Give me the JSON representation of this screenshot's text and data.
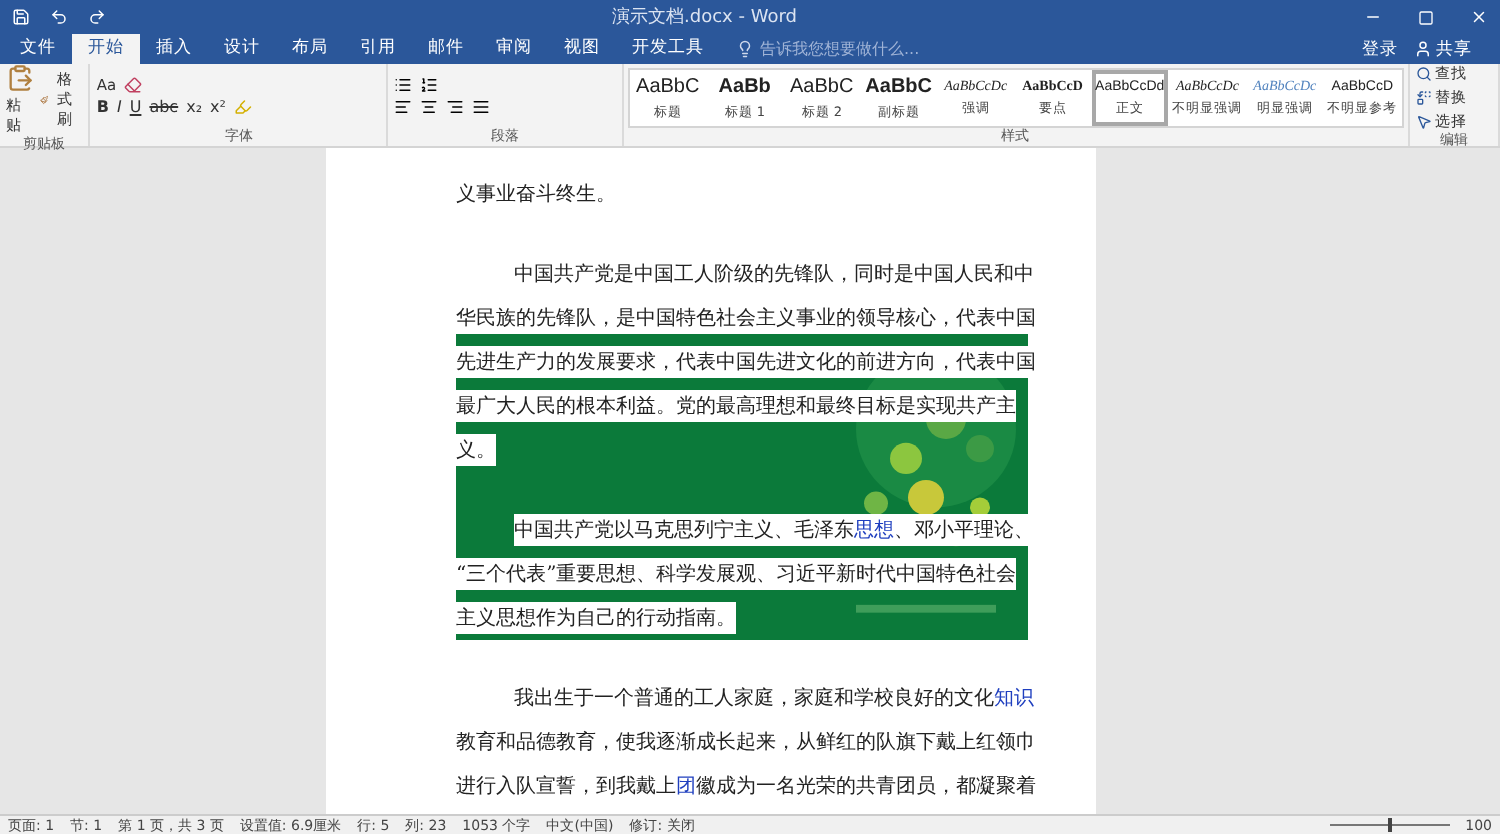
{
  "window": {
    "title": "演示文档.docx - Word"
  },
  "tabs": [
    {
      "label": "文件",
      "selected": false
    },
    {
      "label": "开始",
      "selected": true
    },
    {
      "label": "插入",
      "selected": false
    },
    {
      "label": "设计",
      "selected": false
    },
    {
      "label": "布局",
      "selected": false
    },
    {
      "label": "引用",
      "selected": false
    },
    {
      "label": "邮件",
      "selected": false
    },
    {
      "label": "审阅",
      "selected": false
    },
    {
      "label": "视图",
      "selected": false
    },
    {
      "label": "开发工具",
      "selected": false
    }
  ],
  "tell_me": {
    "placeholder": "告诉我您想要做什么..."
  },
  "account": {
    "sign_in": "登录",
    "share": "共享"
  },
  "ribbon": {
    "clipboard": {
      "paste": "粘贴",
      "format_painter": "格式刷",
      "label": "剪贴板"
    },
    "font": {
      "label": "字体",
      "case_button": "Aa",
      "buttons": [
        "B",
        "I",
        "U",
        "abc",
        "x₂",
        "x²"
      ]
    },
    "paragraph": {
      "label": "段落"
    },
    "styles": {
      "label": "样式",
      "items": [
        {
          "preview": "AaBbC",
          "name": "标题",
          "kind": "heading",
          "selected": false
        },
        {
          "preview": "AaBb",
          "name": "标题 1",
          "kind": "bold",
          "selected": false
        },
        {
          "preview": "AaBbC",
          "name": "标题 2",
          "kind": "heading",
          "selected": false
        },
        {
          "preview": "AaBbC",
          "name": "副标题",
          "kind": "bold",
          "selected": false
        },
        {
          "preview": "AaBbCcDc",
          "name": "强调",
          "kind": "italic",
          "selected": false
        },
        {
          "preview": "AaBbCcD",
          "name": "要点",
          "kind": "strong",
          "selected": false
        },
        {
          "preview": "AaBbCcDd",
          "name": "正文",
          "kind": "plain",
          "selected": true
        },
        {
          "preview": "AaBbCcDc",
          "name": "不明显强调",
          "kind": "italic",
          "selected": false
        },
        {
          "preview": "AaBbCcDc",
          "name": "明显强调",
          "kind": "accent",
          "selected": false
        },
        {
          "preview": "AaBbCcD",
          "name": "不明显参考",
          "kind": "plain",
          "selected": false
        }
      ]
    },
    "editing": {
      "label": "编辑",
      "items": [
        {
          "label": "查找",
          "kind": "find"
        },
        {
          "label": "替换",
          "kind": "replace"
        },
        {
          "label": "选择",
          "kind": "select"
        }
      ]
    }
  },
  "document": {
    "paragraphs": [
      {
        "lines": [
          {
            "segments": [
              {
                "text": "义事业奋斗终生。",
                "link": false
              }
            ]
          }
        ]
      },
      {
        "lines": [
          {
            "segments": [
              {
                "text": "中国共产党是中国工人阶级的先锋队，同时是中国人民和中",
                "link": false
              }
            ]
          },
          {
            "segments": [
              {
                "text": "华民族的先锋队，是中国特色社会主义事业的领导核心，代表中国",
                "link": false
              }
            ]
          },
          {
            "segments": [
              {
                "text": "先进生产力的发展要求，代表中国先进文化的前进方向，代表中国",
                "link": false
              }
            ]
          },
          {
            "segments": [
              {
                "text": "最广大人民的根本利益。党的最高理想和最终目标是实现共产主",
                "link": false
              }
            ]
          },
          {
            "segments": [
              {
                "text": "义。",
                "link": false
              }
            ]
          }
        ]
      },
      {
        "lines": [
          {
            "segments": [
              {
                "text": "中国共产党以马克思列宁主义、毛泽东",
                "link": false
              },
              {
                "text": "思想",
                "link": true
              },
              {
                "text": "、邓小平理论、",
                "link": false
              }
            ]
          },
          {
            "segments": [
              {
                "text": "“三个代表”重要思想、科学发展观、习近平新时代中国特色社会",
                "link": false
              }
            ]
          },
          {
            "segments": [
              {
                "text": "主义思想作为自己的行动指南。",
                "link": false
              }
            ]
          }
        ]
      },
      {
        "lines": [
          {
            "segments": [
              {
                "text": "我出生于一个普通的工人家庭，家庭和学校良好的文化",
                "link": false
              },
              {
                "text": "知识",
                "link": true
              }
            ]
          },
          {
            "segments": [
              {
                "text": "教育和品德教育，使我逐渐成长起来，从鲜红的队旗下戴上红领巾",
                "link": false
              }
            ]
          },
          {
            "segments": [
              {
                "text": "进行入队宣誓，到我戴上",
                "link": false
              },
              {
                "text": "团",
                "link": true
              },
              {
                "text": "徽成为一名光荣的共青团员，都凝聚着",
                "link": false
              }
            ]
          }
        ]
      }
    ]
  },
  "status_bar": {
    "items": [
      "页面: 1",
      "节: 1",
      "第 1 页，共 3 页",
      "设置值: 6.9厘米",
      "行: 5",
      "列: 23",
      "1053 个字",
      "中文(中国)",
      "修订: 关闭"
    ],
    "zoom_slider": {
      "level": 0.5
    },
    "zoom": "100"
  }
}
